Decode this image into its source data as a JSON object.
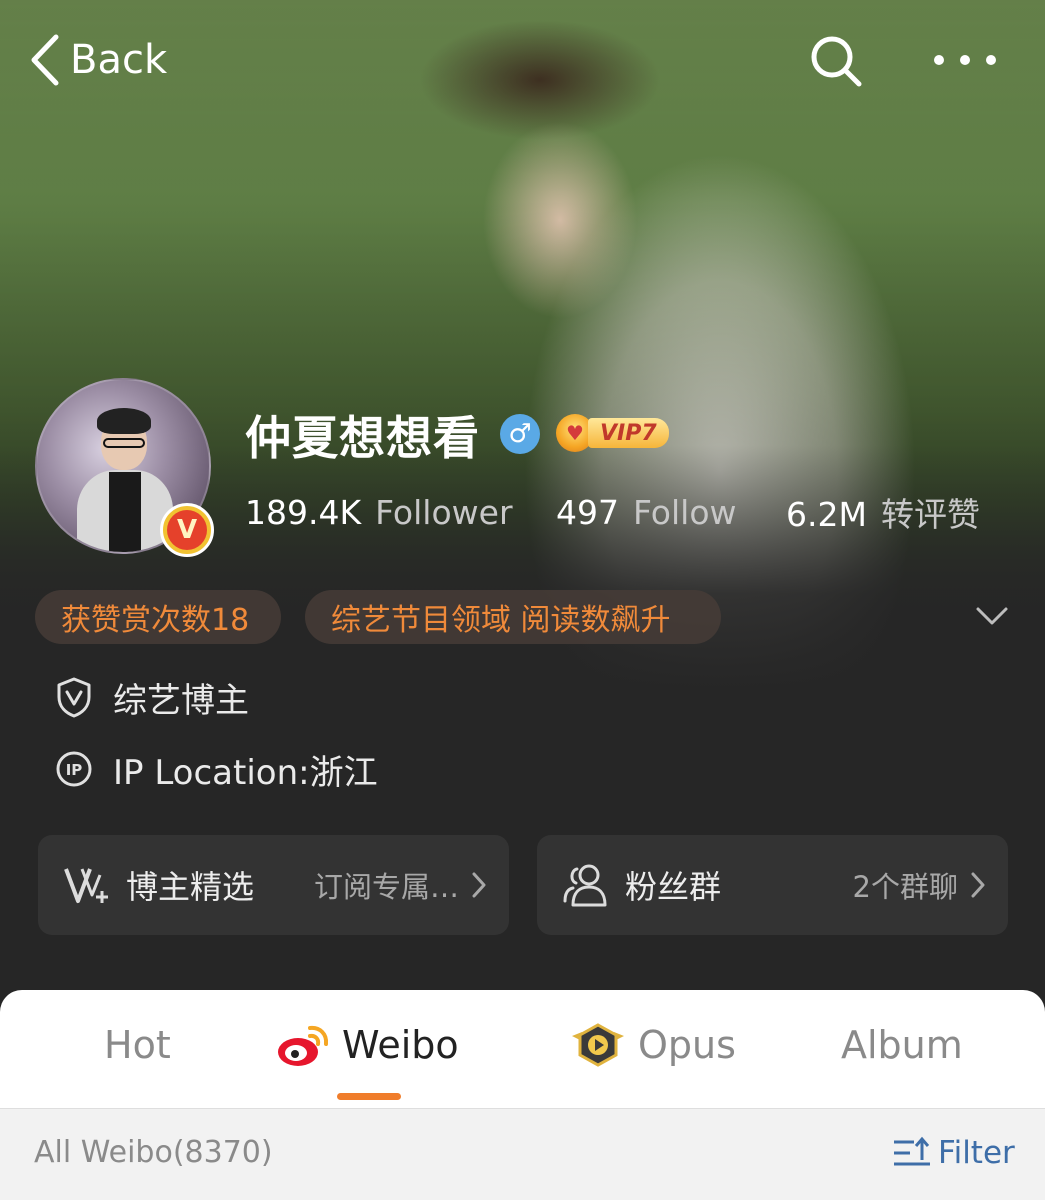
{
  "nav": {
    "back_label": "Back"
  },
  "profile": {
    "username": "仲夏想想看",
    "gender_symbol": "♂",
    "vip_label": "VIP7",
    "verified_symbol": "V",
    "stats": [
      {
        "value": "189.4K",
        "label": "Follower"
      },
      {
        "value": "497",
        "label": "Follow"
      },
      {
        "value": "6.2M",
        "label": "转评赞"
      }
    ],
    "chips": [
      "获赞赏次数18",
      "综艺节目领域 阅读数飙升"
    ],
    "info": {
      "category": "综艺博主",
      "ip_location": "IP Location:浙江"
    }
  },
  "cards": {
    "curated": {
      "title": "博主精选",
      "subtitle": "订阅专属…"
    },
    "fan_group": {
      "title": "粉丝群",
      "subtitle": "2个群聊"
    }
  },
  "tabs": [
    {
      "label": "Hot"
    },
    {
      "label": "Weibo"
    },
    {
      "label": "Opus"
    },
    {
      "label": "Album"
    }
  ],
  "filter_bar": {
    "all_label": "All Weibo(8370)",
    "filter_label": "Filter"
  },
  "colors": {
    "accent_orange": "#f07d2b",
    "filter_blue": "#3e6ea8",
    "gender_blue": "#5aa9e6",
    "dark_bg": "#262626"
  }
}
